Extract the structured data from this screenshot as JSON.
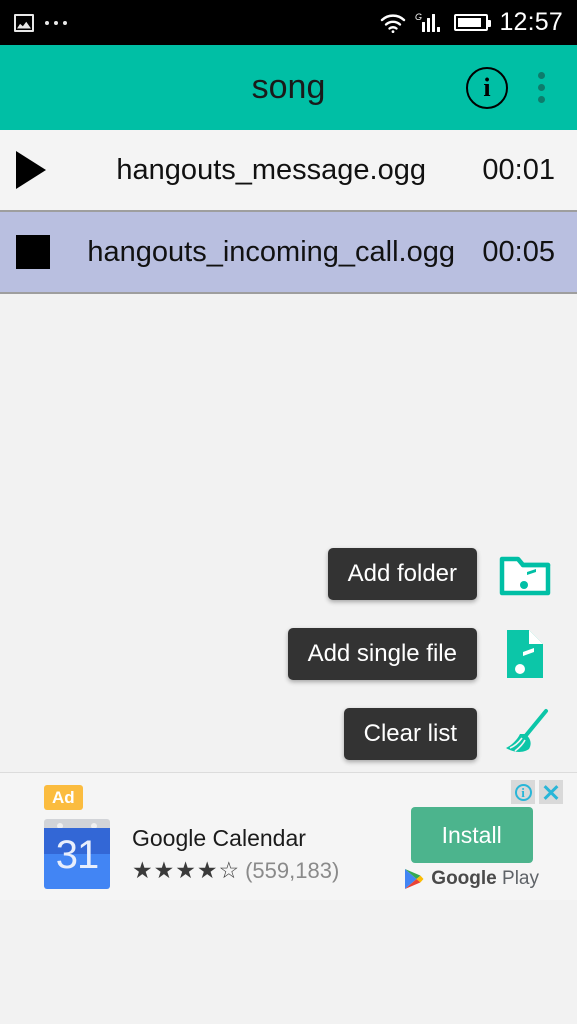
{
  "statusbar": {
    "notification_icon": "screenshot-icon",
    "more_notifications_icon": "more-dots-icon",
    "wifi_icon": "wifi-icon",
    "network_type": "G",
    "signal_icon": "signal-bars-icon",
    "battery_icon": "battery-icon",
    "time": "12:57"
  },
  "appbar": {
    "title": "song",
    "info_label": "i",
    "info_icon": "info-circle-icon",
    "overflow_icon": "overflow-menu-icon",
    "color": "#00bfa5"
  },
  "playlist": {
    "rows": [
      {
        "icon": "play-icon",
        "name": "hangouts_message.ogg",
        "duration": "00:01",
        "selected": false
      },
      {
        "icon": "stop-icon",
        "name": "hangouts_incoming_call.ogg",
        "duration": "00:05",
        "selected": true
      }
    ],
    "selected_color": "#b9bfe0"
  },
  "speed_dial": {
    "items": [
      {
        "label": "Add folder",
        "icon": "folder-music-icon"
      },
      {
        "label": "Add single file",
        "icon": "file-music-icon"
      },
      {
        "label": "Clear list",
        "icon": "broom-icon"
      }
    ],
    "fab": {
      "icon": "close-x-icon",
      "color": "#0a8b78"
    },
    "accent_color": "#00bfa5"
  },
  "ad": {
    "badge": "Ad",
    "info_icon": "ad-info-icon",
    "info_label": "i",
    "close_icon": "ad-close-icon",
    "app_icon": "google-calendar-icon",
    "app_icon_day": "31",
    "title": "Google Calendar",
    "stars": "★★★★☆",
    "rating_count": "(559,183)",
    "install_label": "Install",
    "store_mark_icon": "google-play-icon",
    "store_name_bold": "Google",
    "store_name_light": " Play"
  }
}
